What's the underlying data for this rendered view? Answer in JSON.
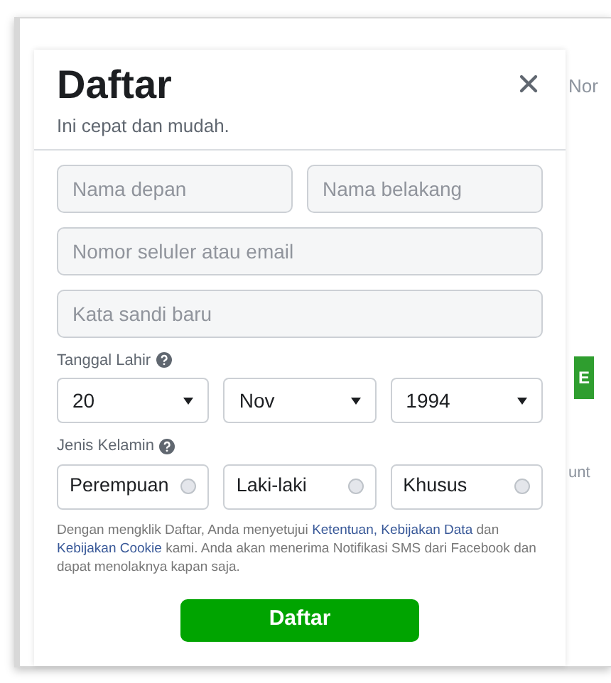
{
  "background": {
    "fragments": [
      "Nor",
      "E",
      "unt"
    ]
  },
  "dialog": {
    "title": "Daftar",
    "subtitle": "Ini cepat dan mudah.",
    "name_fields": [
      {
        "placeholder": "Nama depan"
      },
      {
        "placeholder": "Nama belakang"
      }
    ],
    "fields": [
      {
        "placeholder": "Nomor seluler atau email"
      },
      {
        "placeholder": "Kata sandi baru"
      }
    ],
    "birthday": {
      "label": "Tanggal Lahir",
      "selects": [
        {
          "value": "20"
        },
        {
          "value": "Nov"
        },
        {
          "value": "1994"
        }
      ]
    },
    "gender": {
      "label": "Jenis Kelamin",
      "options": [
        {
          "label": "Perempuan",
          "selected": false
        },
        {
          "label": "Laki-laki",
          "selected": false
        },
        {
          "label": "Khusus",
          "selected": false
        }
      ]
    },
    "legal": [
      {
        "kind": "text",
        "text": "Dengan mengklik Daftar, Anda menyetujui"
      },
      {
        "kind": "link",
        "text": "Ketentuan,"
      },
      {
        "kind": "link",
        "text": "Kebijakan Data"
      },
      {
        "kind": "text",
        "text": "dan"
      },
      {
        "kind": "link",
        "text": "Kebijakan Cookie"
      },
      {
        "kind": "text",
        "text": "kami. Anda akan menerima Notifikasi SMS dari Facebook dan dapat menolaknya kapan saja."
      }
    ],
    "submit": "Daftar"
  }
}
